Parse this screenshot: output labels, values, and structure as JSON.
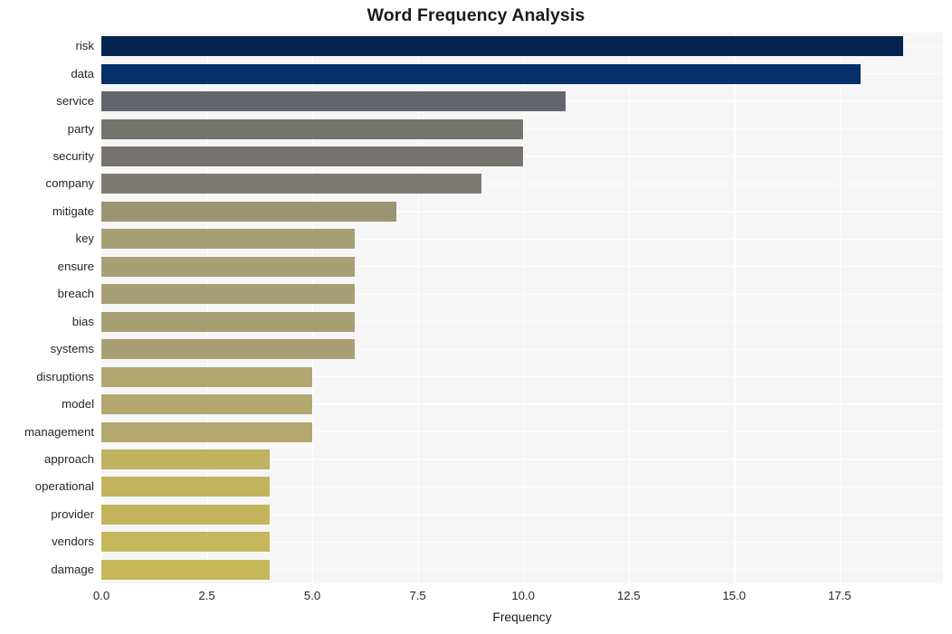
{
  "chart_data": {
    "type": "bar",
    "orientation": "horizontal",
    "title": "Word Frequency Analysis",
    "xlabel": "Frequency",
    "ylabel": "",
    "xlim": [
      0,
      19.95
    ],
    "xticks": [
      "0.0",
      "2.5",
      "5.0",
      "7.5",
      "10.0",
      "12.5",
      "15.0",
      "17.5"
    ],
    "xtick_values": [
      0,
      2.5,
      5,
      7.5,
      10,
      12.5,
      15,
      17.5
    ],
    "grid": true,
    "legend": null,
    "categories": [
      "risk",
      "data",
      "service",
      "party",
      "security",
      "company",
      "mitigate",
      "key",
      "ensure",
      "breach",
      "bias",
      "systems",
      "disruptions",
      "model",
      "management",
      "approach",
      "operational",
      "provider",
      "vendors",
      "damage"
    ],
    "values": [
      19,
      18,
      11,
      10,
      10,
      9,
      7,
      6,
      6,
      6,
      6,
      6,
      5,
      5,
      5,
      4,
      4,
      4,
      4,
      4
    ],
    "bar_colors": [
      "#03254f",
      "#053069",
      "#62656b",
      "#74746f",
      "#76736f",
      "#7d7a71",
      "#9a9472",
      "#a79f74",
      "#a89f74",
      "#a99f74",
      "#aa9f74",
      "#aa9f74",
      "#b2a671",
      "#b3a76f",
      "#b4a86e",
      "#c0b25e",
      "#c2b45d",
      "#c3b55c",
      "#c4b65b",
      "#c5b75a"
    ]
  },
  "axes": {
    "plot_background": "#f6f6f7",
    "grid_color": "#ffffff",
    "figure_background": "#ffffff",
    "tick_color": "#262626"
  }
}
